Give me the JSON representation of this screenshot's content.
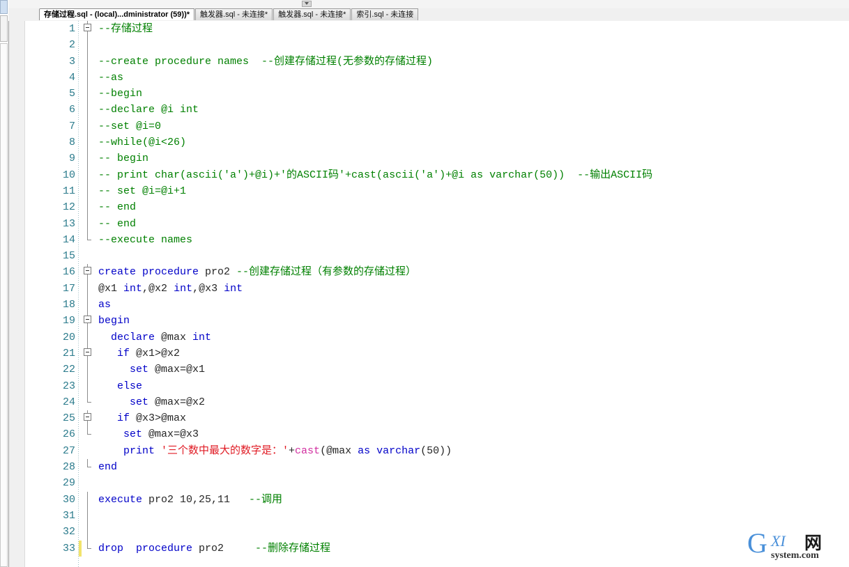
{
  "window": {
    "title": "存储过程.sql - (local)...dministrator (59))*"
  },
  "tabs": [
    {
      "label": "存储过程.sql - (local)...dministrator (59))*",
      "active": true
    },
    {
      "label": "触发器.sql - 未连接*",
      "active": false
    },
    {
      "label": "触发器.sql - 未连接*",
      "active": false
    },
    {
      "label": "索引.sql - 未连接",
      "active": false
    }
  ],
  "editor": {
    "language": "sql",
    "colors": {
      "keyword": "#0000c8",
      "comment": "#008000",
      "string": "#e01b24",
      "function": "#d12ea0",
      "identifier": "#262626",
      "line_number": "#2b7b8c",
      "change_bar": "#f2e36b",
      "background": "#ffffff"
    },
    "lines": [
      {
        "n": 1,
        "fold": "box",
        "change": false,
        "tokens": [
          {
            "t": "--存储过程",
            "c": "cm"
          }
        ]
      },
      {
        "n": 2,
        "fold": "line",
        "change": false,
        "tokens": []
      },
      {
        "n": 3,
        "fold": "line",
        "change": false,
        "tokens": [
          {
            "t": "--create procedure names  --创建存储过程(无参数的存储过程)",
            "c": "cm"
          }
        ]
      },
      {
        "n": 4,
        "fold": "line",
        "change": false,
        "tokens": [
          {
            "t": "--as",
            "c": "cm"
          }
        ]
      },
      {
        "n": 5,
        "fold": "line",
        "change": false,
        "tokens": [
          {
            "t": "--begin",
            "c": "cm"
          }
        ]
      },
      {
        "n": 6,
        "fold": "line",
        "change": false,
        "tokens": [
          {
            "t": "--declare @i int",
            "c": "cm"
          }
        ]
      },
      {
        "n": 7,
        "fold": "line",
        "change": false,
        "tokens": [
          {
            "t": "--set @i=0",
            "c": "cm"
          }
        ]
      },
      {
        "n": 8,
        "fold": "line",
        "change": false,
        "tokens": [
          {
            "t": "--while(@i<26)",
            "c": "cm"
          }
        ]
      },
      {
        "n": 9,
        "fold": "line",
        "change": false,
        "tokens": [
          {
            "t": "-- begin",
            "c": "cm"
          }
        ]
      },
      {
        "n": 10,
        "fold": "line",
        "change": false,
        "tokens": [
          {
            "t": "-- print char(ascii('a')+@i)+'的ASCII码'+cast(ascii('a')+@i as varchar(50))  --输出ASCII码",
            "c": "cm"
          }
        ]
      },
      {
        "n": 11,
        "fold": "line",
        "change": false,
        "tokens": [
          {
            "t": "-- set @i=@i+1",
            "c": "cm"
          }
        ]
      },
      {
        "n": 12,
        "fold": "line",
        "change": false,
        "tokens": [
          {
            "t": "-- end",
            "c": "cm"
          }
        ]
      },
      {
        "n": 13,
        "fold": "line",
        "change": false,
        "tokens": [
          {
            "t": "-- end",
            "c": "cm"
          }
        ]
      },
      {
        "n": 14,
        "fold": "end",
        "change": false,
        "tokens": [
          {
            "t": "--execute names",
            "c": "cm"
          }
        ]
      },
      {
        "n": 15,
        "fold": "none",
        "change": false,
        "tokens": []
      },
      {
        "n": 16,
        "fold": "box",
        "change": false,
        "tokens": [
          {
            "t": "create procedure ",
            "c": "kw"
          },
          {
            "t": "pro2 ",
            "c": "id"
          },
          {
            "t": "--创建存储过程（有参数的存储过程）",
            "c": "cm"
          }
        ]
      },
      {
        "n": 17,
        "fold": "line",
        "change": false,
        "tokens": [
          {
            "t": "@x1 ",
            "c": "id"
          },
          {
            "t": "int",
            "c": "kw"
          },
          {
            "t": ",",
            "c": "id"
          },
          {
            "t": "@x2 ",
            "c": "id"
          },
          {
            "t": "int",
            "c": "kw"
          },
          {
            "t": ",",
            "c": "id"
          },
          {
            "t": "@x3 ",
            "c": "id"
          },
          {
            "t": "int",
            "c": "kw"
          }
        ]
      },
      {
        "n": 18,
        "fold": "line",
        "change": false,
        "tokens": [
          {
            "t": "as",
            "c": "kw"
          }
        ]
      },
      {
        "n": 19,
        "fold": "box",
        "change": false,
        "tokens": [
          {
            "t": "begin",
            "c": "kw"
          }
        ]
      },
      {
        "n": 20,
        "fold": "line",
        "change": false,
        "tokens": [
          {
            "t": "  declare ",
            "c": "kw"
          },
          {
            "t": "@max ",
            "c": "id"
          },
          {
            "t": "int",
            "c": "kw"
          }
        ]
      },
      {
        "n": 21,
        "fold": "box",
        "change": false,
        "tokens": [
          {
            "t": "   if ",
            "c": "kw"
          },
          {
            "t": "@x1>@x2",
            "c": "id"
          }
        ]
      },
      {
        "n": 22,
        "fold": "line",
        "change": false,
        "tokens": [
          {
            "t": "     set ",
            "c": "kw"
          },
          {
            "t": "@max=@x1",
            "c": "id"
          }
        ]
      },
      {
        "n": 23,
        "fold": "line",
        "change": false,
        "tokens": [
          {
            "t": "   else",
            "c": "kw"
          }
        ]
      },
      {
        "n": 24,
        "fold": "end",
        "change": false,
        "tokens": [
          {
            "t": "     set ",
            "c": "kw"
          },
          {
            "t": "@max=@x2",
            "c": "id"
          }
        ]
      },
      {
        "n": 25,
        "fold": "box",
        "change": false,
        "tokens": [
          {
            "t": "   if ",
            "c": "kw"
          },
          {
            "t": "@x3>@max",
            "c": "id"
          }
        ]
      },
      {
        "n": 26,
        "fold": "end",
        "change": false,
        "tokens": [
          {
            "t": "    set ",
            "c": "kw"
          },
          {
            "t": "@max=@x3",
            "c": "id"
          }
        ]
      },
      {
        "n": 27,
        "fold": "none",
        "change": false,
        "tokens": [
          {
            "t": "    print ",
            "c": "kw"
          },
          {
            "t": "'三个数中最大的数字是：'",
            "c": "str"
          },
          {
            "t": "+",
            "c": "id"
          },
          {
            "t": "cast",
            "c": "fn"
          },
          {
            "t": "(@max ",
            "c": "id"
          },
          {
            "t": "as varchar",
            "c": "kw"
          },
          {
            "t": "(50))",
            "c": "id"
          }
        ]
      },
      {
        "n": 28,
        "fold": "end",
        "change": false,
        "tokens": [
          {
            "t": "end",
            "c": "kw"
          }
        ]
      },
      {
        "n": 29,
        "fold": "none",
        "change": false,
        "tokens": []
      },
      {
        "n": 30,
        "fold": "line",
        "change": false,
        "tokens": [
          {
            "t": "execute ",
            "c": "kw"
          },
          {
            "t": "pro2 10,25,11   ",
            "c": "id"
          },
          {
            "t": "--调用",
            "c": "cm"
          }
        ]
      },
      {
        "n": 31,
        "fold": "line",
        "change": false,
        "tokens": []
      },
      {
        "n": 32,
        "fold": "line",
        "change": false,
        "tokens": []
      },
      {
        "n": 33,
        "fold": "end",
        "change": true,
        "tokens": [
          {
            "t": "drop  procedure ",
            "c": "kw"
          },
          {
            "t": "pro2     ",
            "c": "id"
          },
          {
            "t": "--删除存储过程",
            "c": "cm"
          }
        ]
      }
    ]
  },
  "watermark": {
    "g": "G",
    "xi": "XI",
    "wang": "网",
    "site": "system.com"
  }
}
